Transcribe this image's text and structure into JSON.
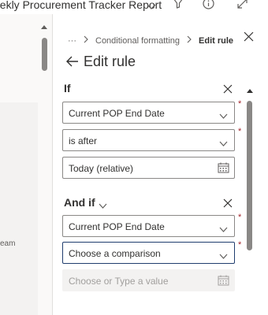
{
  "header": {
    "report_title": "eekly Procurement Tracker Report",
    "icons": [
      "chevron-down-icon",
      "filter-icon",
      "info-icon",
      "expand-icon"
    ]
  },
  "left": {
    "partial_text": "eam"
  },
  "pane": {
    "breadcrumb": {
      "ellipsis": "···",
      "parent": "Conditional formatting",
      "current": "Edit rule"
    },
    "title": "Edit rule",
    "if_section": {
      "label": "If",
      "field_value": "Current POP End Date",
      "operator_value": "is after",
      "date_value": "Today (relative)"
    },
    "and_if_section": {
      "label": "And if",
      "field_value": "Current POP End Date",
      "operator_placeholder": "Choose a comparison",
      "value_placeholder": "Choose or Type a value"
    },
    "required_marker": "*"
  },
  "colors": {
    "accent_border": "#1f3d6e",
    "required": "#a4262c",
    "text": "#323130",
    "muted": "#605e5c"
  }
}
